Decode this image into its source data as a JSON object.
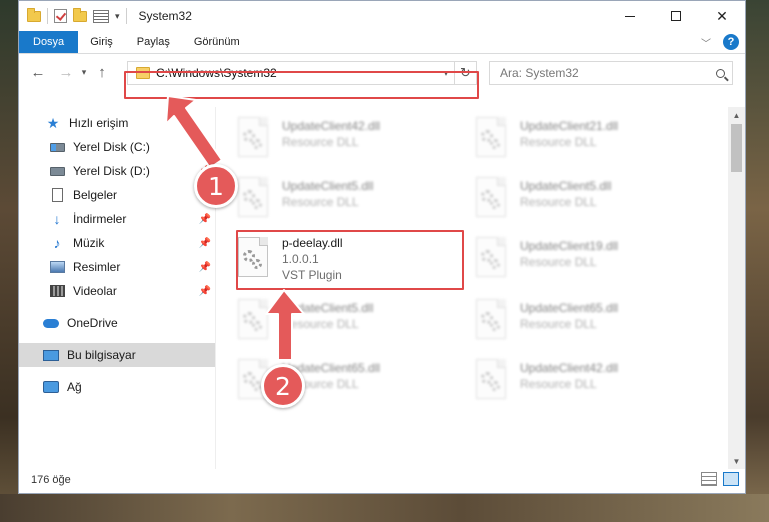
{
  "window": {
    "title": "System32",
    "minimize_glyph": "—",
    "close_glyph": "✕"
  },
  "ribbon": {
    "tabs": [
      "Dosya",
      "Giriş",
      "Paylaş",
      "Görünüm"
    ],
    "help_glyph": "?"
  },
  "navigation": {
    "back_glyph": "←",
    "forward_glyph": "→",
    "recent_glyph": "▾",
    "up_glyph": "↑",
    "address": "C:\\Windows\\System32",
    "refresh_glyph": "↻",
    "search_placeholder": "Ara: System32"
  },
  "nav_pane": {
    "items": [
      {
        "label": "Hızlı erişim",
        "icon": "star-icon",
        "pinned": false
      },
      {
        "label": "Yerel Disk (C:)",
        "icon": "drive-c-icon",
        "pinned": true
      },
      {
        "label": "Yerel Disk (D:)",
        "icon": "drive-d-icon",
        "pinned": true
      },
      {
        "label": "Belgeler",
        "icon": "documents-icon",
        "pinned": true
      },
      {
        "label": "İndirmeler",
        "icon": "downloads-icon",
        "pinned": true
      },
      {
        "label": "Müzik",
        "icon": "music-icon",
        "pinned": true
      },
      {
        "label": "Resimler",
        "icon": "pictures-icon",
        "pinned": true
      },
      {
        "label": "Videolar",
        "icon": "videos-icon",
        "pinned": true
      },
      {
        "label": "OneDrive",
        "icon": "onedrive-icon",
        "pinned": false
      },
      {
        "label": "Bu bilgisayar",
        "icon": "this-pc-icon",
        "pinned": false,
        "selected": true
      },
      {
        "label": "Ağ",
        "icon": "network-icon",
        "pinned": false
      }
    ]
  },
  "files": [
    {
      "name": "UpdateClient42.dll",
      "sub": "Resource DLL",
      "faded": true
    },
    {
      "name": "UpdateClient21.dll",
      "sub": "Resource DLL",
      "faded": true
    },
    {
      "name": "UpdateClient5.dll",
      "sub": "Resource DLL",
      "faded": true
    },
    {
      "name": "UpdateClient5.dll",
      "sub": "Resource DLL",
      "faded": true
    },
    {
      "name": "p-deelay.dll",
      "sub": "1.0.0.1",
      "sub2": "VST Plugin",
      "faded": false
    },
    {
      "name": "UpdateClient19.dll",
      "sub": "Resource DLL",
      "faded": true
    },
    {
      "name": "UpdateClient5.dll",
      "sub": "Resource DLL",
      "faded": true
    },
    {
      "name": "UpdateClient65.dll",
      "sub": "Resource DLL",
      "faded": true
    },
    {
      "name": "UpdateClient65.dll",
      "sub": "Resource DLL",
      "faded": true
    },
    {
      "name": "UpdateClient42.dll",
      "sub": "Resource DLL",
      "faded": true
    }
  ],
  "status": {
    "item_count": "176 öğe"
  },
  "annotations": {
    "step1": "1",
    "step2": "2",
    "color": "#e04848"
  }
}
